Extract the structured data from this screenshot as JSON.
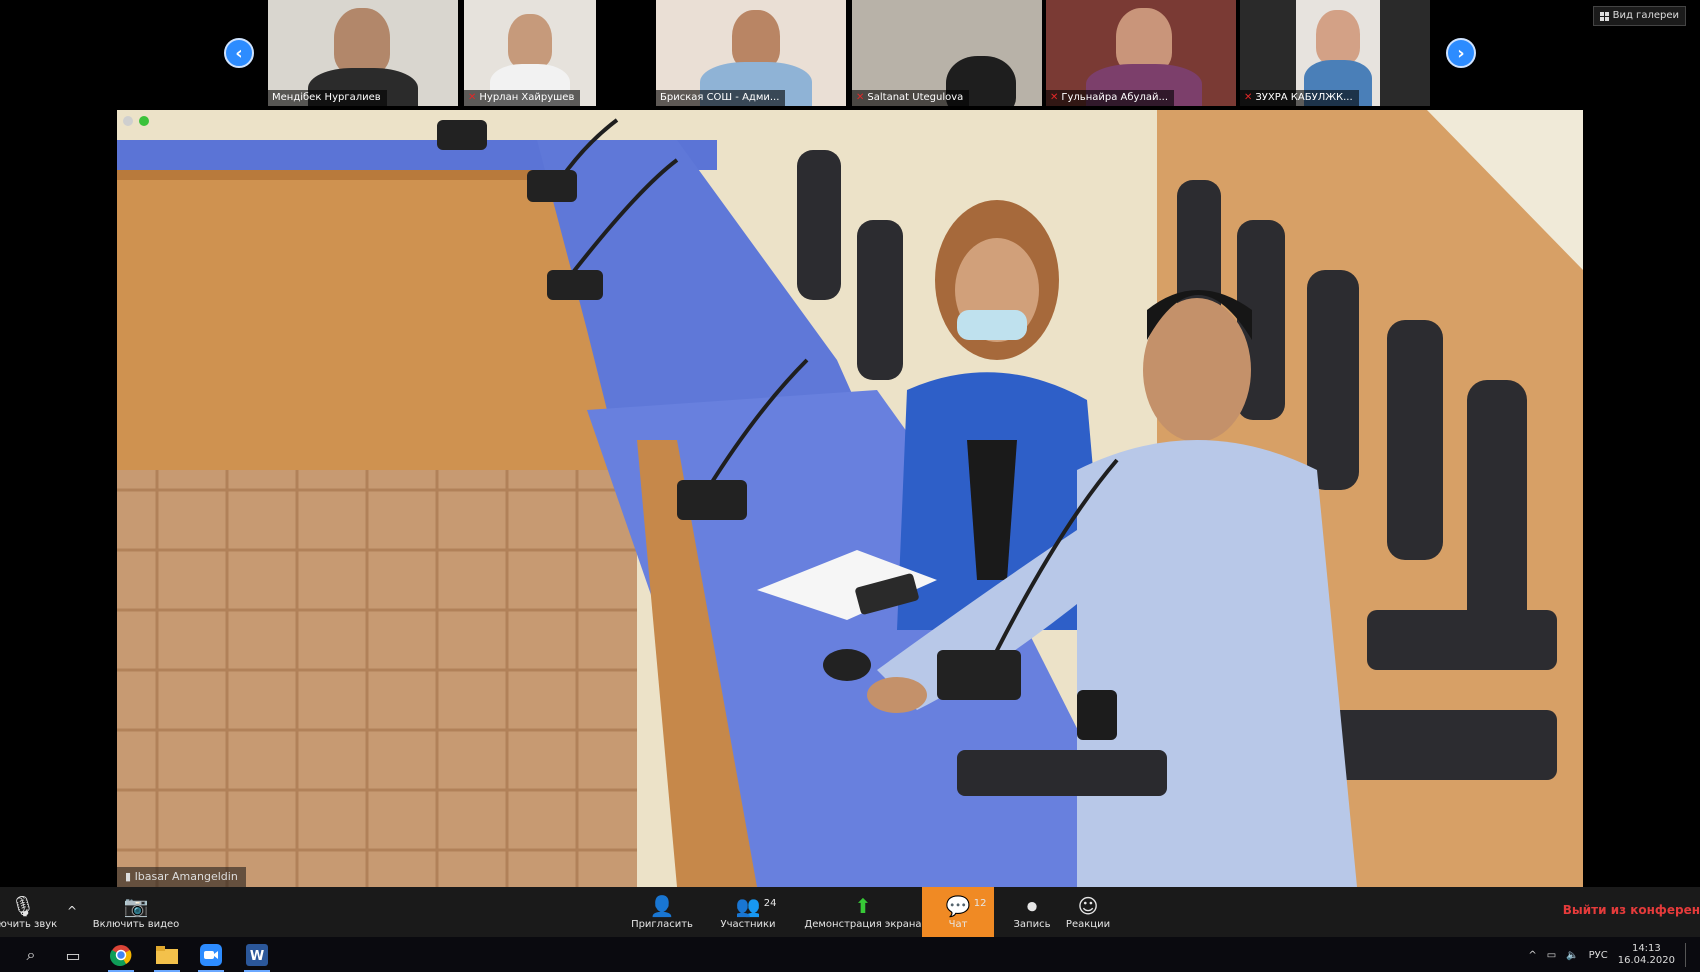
{
  "gallery": {
    "prev_arrow": "‹",
    "next_arrow": "›",
    "view_button_label": "Вид галереи",
    "participants": [
      {
        "name": "Мендібек Нургалиев",
        "muted": false
      },
      {
        "name": "Нурлан Хайрушев",
        "muted": true
      },
      {
        "name": "Бриская СОШ - Адми...",
        "muted": false
      },
      {
        "name": "Saltanat Utegulova",
        "muted": true
      },
      {
        "name": "Гульнайра Абулай...",
        "muted": true
      },
      {
        "name": "ЗУХРА КАБУЛЖК...",
        "muted": true
      }
    ]
  },
  "main_video": {
    "speaker_name": "Ibasar Amangeldin"
  },
  "toolbar": {
    "audio_label": "...ючить звук",
    "video_label": "Включить видео",
    "invite_label": "Пригласить",
    "participants_label": "Участники",
    "participants_count": "24",
    "share_label": "Демонстрация экрана",
    "chat_label": "Чат",
    "chat_count": "12",
    "record_label": "Запись",
    "reactions_label": "Реакции",
    "leave_label": "Выйти из конферен",
    "active_color": "#f08a24",
    "leave_color": "#e53b3b"
  },
  "taskbar": {
    "language": "РУС",
    "time": "14:13",
    "date": "16.04.2020"
  }
}
